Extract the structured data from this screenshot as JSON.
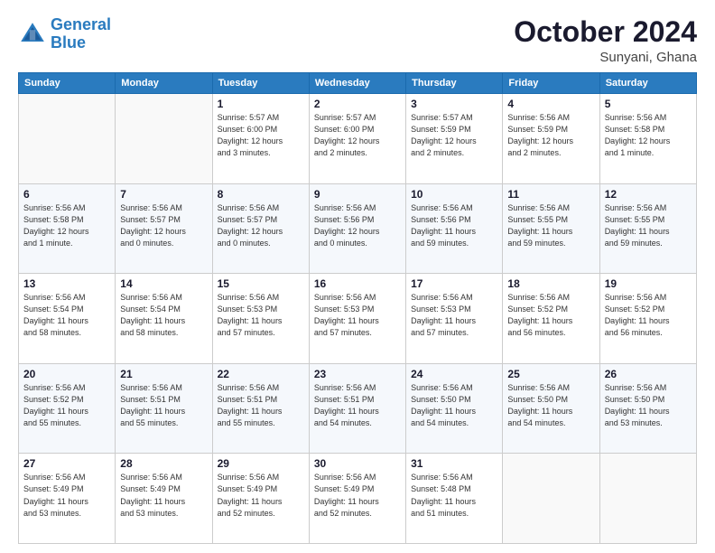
{
  "header": {
    "logo_line1": "General",
    "logo_line2": "Blue",
    "month": "October 2024",
    "location": "Sunyani, Ghana"
  },
  "weekdays": [
    "Sunday",
    "Monday",
    "Tuesday",
    "Wednesday",
    "Thursday",
    "Friday",
    "Saturday"
  ],
  "weeks": [
    [
      {
        "day": "",
        "info": ""
      },
      {
        "day": "",
        "info": ""
      },
      {
        "day": "1",
        "info": "Sunrise: 5:57 AM\nSunset: 6:00 PM\nDaylight: 12 hours\nand 3 minutes."
      },
      {
        "day": "2",
        "info": "Sunrise: 5:57 AM\nSunset: 6:00 PM\nDaylight: 12 hours\nand 2 minutes."
      },
      {
        "day": "3",
        "info": "Sunrise: 5:57 AM\nSunset: 5:59 PM\nDaylight: 12 hours\nand 2 minutes."
      },
      {
        "day": "4",
        "info": "Sunrise: 5:56 AM\nSunset: 5:59 PM\nDaylight: 12 hours\nand 2 minutes."
      },
      {
        "day": "5",
        "info": "Sunrise: 5:56 AM\nSunset: 5:58 PM\nDaylight: 12 hours\nand 1 minute."
      }
    ],
    [
      {
        "day": "6",
        "info": "Sunrise: 5:56 AM\nSunset: 5:58 PM\nDaylight: 12 hours\nand 1 minute."
      },
      {
        "day": "7",
        "info": "Sunrise: 5:56 AM\nSunset: 5:57 PM\nDaylight: 12 hours\nand 0 minutes."
      },
      {
        "day": "8",
        "info": "Sunrise: 5:56 AM\nSunset: 5:57 PM\nDaylight: 12 hours\nand 0 minutes."
      },
      {
        "day": "9",
        "info": "Sunrise: 5:56 AM\nSunset: 5:56 PM\nDaylight: 12 hours\nand 0 minutes."
      },
      {
        "day": "10",
        "info": "Sunrise: 5:56 AM\nSunset: 5:56 PM\nDaylight: 11 hours\nand 59 minutes."
      },
      {
        "day": "11",
        "info": "Sunrise: 5:56 AM\nSunset: 5:55 PM\nDaylight: 11 hours\nand 59 minutes."
      },
      {
        "day": "12",
        "info": "Sunrise: 5:56 AM\nSunset: 5:55 PM\nDaylight: 11 hours\nand 59 minutes."
      }
    ],
    [
      {
        "day": "13",
        "info": "Sunrise: 5:56 AM\nSunset: 5:54 PM\nDaylight: 11 hours\nand 58 minutes."
      },
      {
        "day": "14",
        "info": "Sunrise: 5:56 AM\nSunset: 5:54 PM\nDaylight: 11 hours\nand 58 minutes."
      },
      {
        "day": "15",
        "info": "Sunrise: 5:56 AM\nSunset: 5:53 PM\nDaylight: 11 hours\nand 57 minutes."
      },
      {
        "day": "16",
        "info": "Sunrise: 5:56 AM\nSunset: 5:53 PM\nDaylight: 11 hours\nand 57 minutes."
      },
      {
        "day": "17",
        "info": "Sunrise: 5:56 AM\nSunset: 5:53 PM\nDaylight: 11 hours\nand 57 minutes."
      },
      {
        "day": "18",
        "info": "Sunrise: 5:56 AM\nSunset: 5:52 PM\nDaylight: 11 hours\nand 56 minutes."
      },
      {
        "day": "19",
        "info": "Sunrise: 5:56 AM\nSunset: 5:52 PM\nDaylight: 11 hours\nand 56 minutes."
      }
    ],
    [
      {
        "day": "20",
        "info": "Sunrise: 5:56 AM\nSunset: 5:52 PM\nDaylight: 11 hours\nand 55 minutes."
      },
      {
        "day": "21",
        "info": "Sunrise: 5:56 AM\nSunset: 5:51 PM\nDaylight: 11 hours\nand 55 minutes."
      },
      {
        "day": "22",
        "info": "Sunrise: 5:56 AM\nSunset: 5:51 PM\nDaylight: 11 hours\nand 55 minutes."
      },
      {
        "day": "23",
        "info": "Sunrise: 5:56 AM\nSunset: 5:51 PM\nDaylight: 11 hours\nand 54 minutes."
      },
      {
        "day": "24",
        "info": "Sunrise: 5:56 AM\nSunset: 5:50 PM\nDaylight: 11 hours\nand 54 minutes."
      },
      {
        "day": "25",
        "info": "Sunrise: 5:56 AM\nSunset: 5:50 PM\nDaylight: 11 hours\nand 54 minutes."
      },
      {
        "day": "26",
        "info": "Sunrise: 5:56 AM\nSunset: 5:50 PM\nDaylight: 11 hours\nand 53 minutes."
      }
    ],
    [
      {
        "day": "27",
        "info": "Sunrise: 5:56 AM\nSunset: 5:49 PM\nDaylight: 11 hours\nand 53 minutes."
      },
      {
        "day": "28",
        "info": "Sunrise: 5:56 AM\nSunset: 5:49 PM\nDaylight: 11 hours\nand 53 minutes."
      },
      {
        "day": "29",
        "info": "Sunrise: 5:56 AM\nSunset: 5:49 PM\nDaylight: 11 hours\nand 52 minutes."
      },
      {
        "day": "30",
        "info": "Sunrise: 5:56 AM\nSunset: 5:49 PM\nDaylight: 11 hours\nand 52 minutes."
      },
      {
        "day": "31",
        "info": "Sunrise: 5:56 AM\nSunset: 5:48 PM\nDaylight: 11 hours\nand 51 minutes."
      },
      {
        "day": "",
        "info": ""
      },
      {
        "day": "",
        "info": ""
      }
    ]
  ]
}
